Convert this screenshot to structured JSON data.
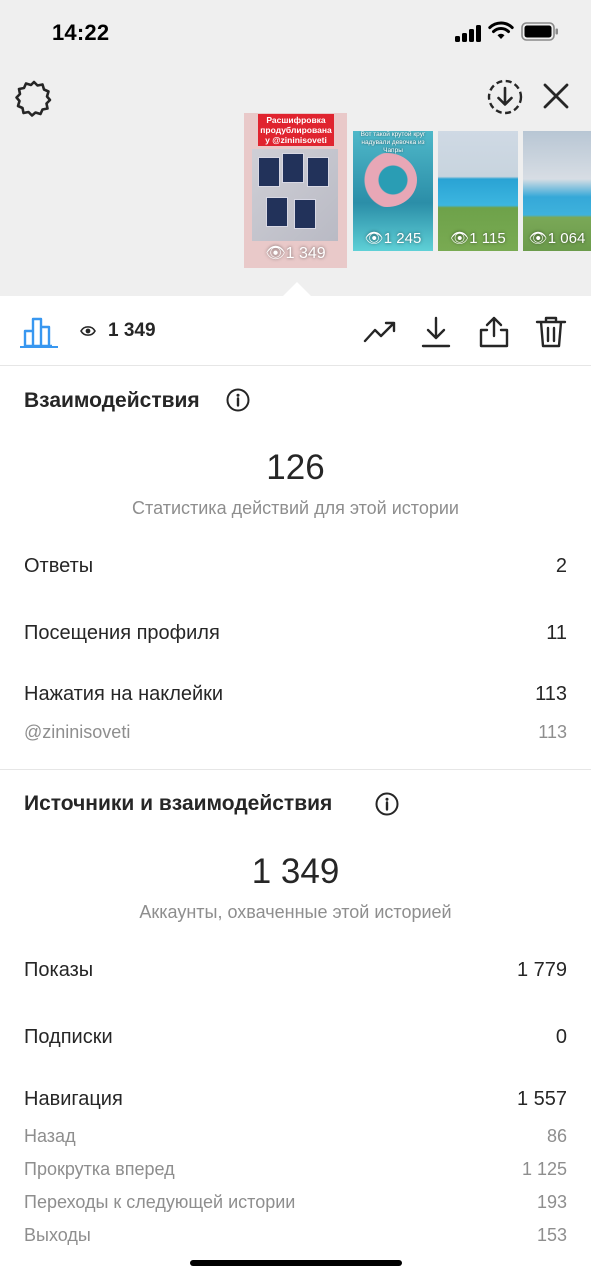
{
  "status_bar": {
    "time": "14:22"
  },
  "thumbnails": [
    {
      "banner": "Расшифровка продублирована у @zininisoveti",
      "views": "1 349",
      "selected": true
    },
    {
      "caption": "Вот такой крутой круг надували девочка из Чапры",
      "views": "1 245"
    },
    {
      "views": "1 115"
    },
    {
      "views": "1 064"
    }
  ],
  "toolbar": {
    "views_count": "1 349",
    "icons": [
      "insights-icon",
      "eye-icon",
      "trend-icon",
      "download-icon",
      "share-icon",
      "trash-icon"
    ]
  },
  "interactions": {
    "title": "Взаимодействия",
    "total": "126",
    "total_caption": "Статистика действий для этой истории",
    "rows": [
      {
        "label": "Ответы",
        "value": "2"
      },
      {
        "label": "Посещения профиля",
        "value": "11"
      },
      {
        "label": "Нажатия на наклейки",
        "value": "113"
      }
    ],
    "sticker": {
      "label": "@zininisoveti",
      "value": "113"
    }
  },
  "discovery": {
    "title": "Источники и взаимодействия",
    "total": "1 349",
    "total_caption": "Аккаунты, охваченные этой историей",
    "rows": [
      {
        "label": "Показы",
        "value": "1 779"
      },
      {
        "label": "Подписки",
        "value": "0"
      },
      {
        "label": "Навигация",
        "value": "1 557"
      }
    ],
    "navigation": [
      {
        "label": "Назад",
        "value": "86"
      },
      {
        "label": "Прокрутка вперед",
        "value": "1 125"
      },
      {
        "label": "Переходы к следующей истории",
        "value": "193"
      },
      {
        "label": "Выходы",
        "value": "153"
      }
    ]
  },
  "colors": {
    "accent": "#3897f0",
    "text": "#262626",
    "muted": "#8e8e8e",
    "top_bg": "#efefef"
  }
}
